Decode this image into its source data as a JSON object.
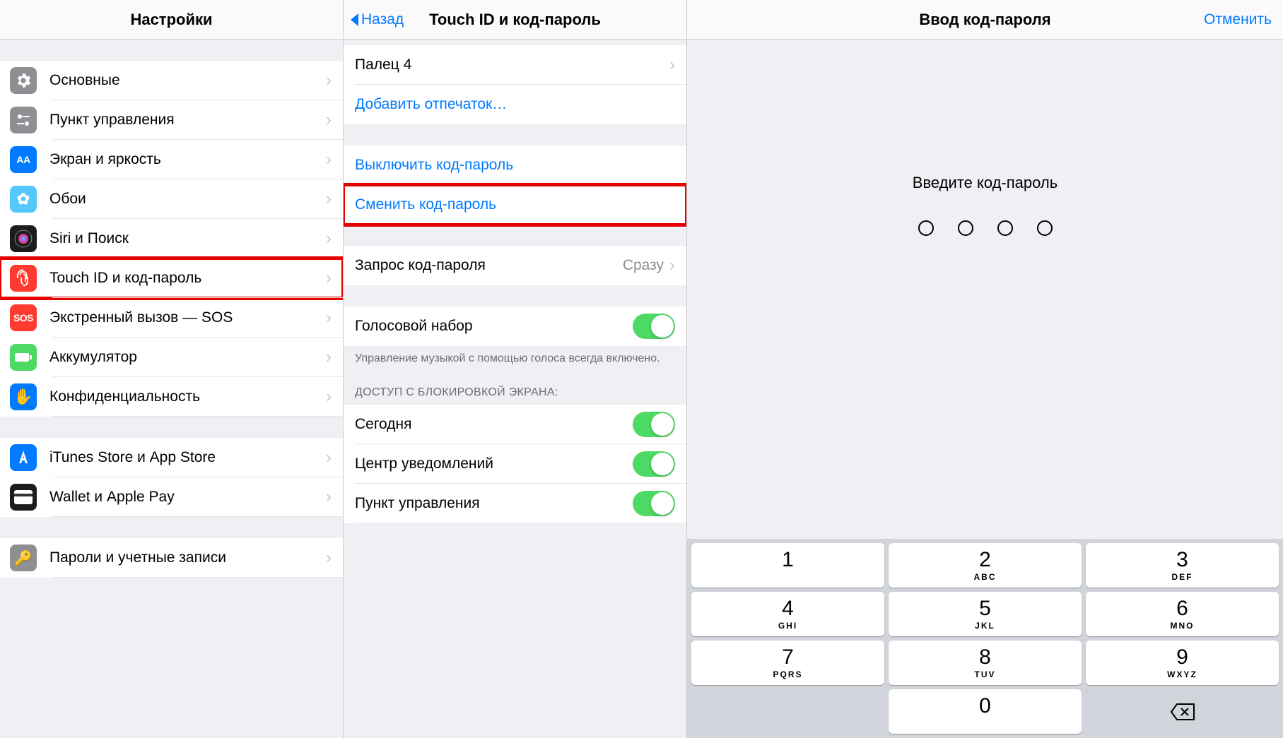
{
  "col1": {
    "title": "Настройки",
    "items": [
      {
        "label": "Основные",
        "icon": "gear",
        "color": "ic-gray"
      },
      {
        "label": "Пункт управления",
        "icon": "sliders",
        "color": "ic-control"
      },
      {
        "label": "Экран и яркость",
        "icon": "AA",
        "color": "ic-blue"
      },
      {
        "label": "Обои",
        "icon": "flower",
        "color": "ic-bluewp"
      },
      {
        "label": "Siri и Поиск",
        "icon": "siri",
        "color": "ic-black"
      },
      {
        "label": "Touch ID и код-пароль",
        "icon": "finger",
        "color": "ic-red",
        "highlight": true
      },
      {
        "label": "Экстренный вызов — SOS",
        "icon": "SOS",
        "color": "ic-sos"
      },
      {
        "label": "Аккумулятор",
        "icon": "battery",
        "color": "ic-green"
      },
      {
        "label": "Конфиденциальность",
        "icon": "hand",
        "color": "ic-bluepr"
      }
    ],
    "items2": [
      {
        "label": "iTunes Store и App Store",
        "icon": "A",
        "color": "ic-blue"
      },
      {
        "label": "Wallet и Apple Pay",
        "icon": "wallet",
        "color": "ic-black"
      }
    ],
    "items3": [
      {
        "label": "Пароли и учетные записи",
        "icon": "key",
        "color": "ic-gray"
      }
    ]
  },
  "col2": {
    "back": "Назад",
    "title": "Touch ID и код-пароль",
    "finger_rows": [
      {
        "label": "Палец 4"
      }
    ],
    "add_fingerprint": "Добавить отпечаток…",
    "disable_passcode": "Выключить код-пароль",
    "change_passcode": "Сменить код-пароль",
    "require": {
      "label": "Запрос код-пароля",
      "value": "Сразу"
    },
    "voice_dial": {
      "label": "Голосовой набор",
      "footer": "Управление музыкой с помощью голоса всегда включено."
    },
    "lock_header": "ДОСТУП С БЛОКИРОВКОЙ ЭКРАНА:",
    "lock_items": [
      {
        "label": "Сегодня"
      },
      {
        "label": "Центр уведомлений"
      },
      {
        "label": "Пункт управления"
      }
    ]
  },
  "col3": {
    "title": "Ввод код-пароля",
    "cancel": "Отменить",
    "prompt": "Введите код-пароль",
    "keypad": [
      [
        {
          "n": "1",
          "l": ""
        },
        {
          "n": "2",
          "l": "ABC"
        },
        {
          "n": "3",
          "l": "DEF"
        }
      ],
      [
        {
          "n": "4",
          "l": "GHI"
        },
        {
          "n": "5",
          "l": "JKL"
        },
        {
          "n": "6",
          "l": "MNO"
        }
      ],
      [
        {
          "n": "7",
          "l": "PQRS"
        },
        {
          "n": "8",
          "l": "TUV"
        },
        {
          "n": "9",
          "l": "WXYZ"
        }
      ],
      [
        {
          "blank": true
        },
        {
          "n": "0",
          "l": ""
        },
        {
          "del": true
        }
      ]
    ]
  }
}
